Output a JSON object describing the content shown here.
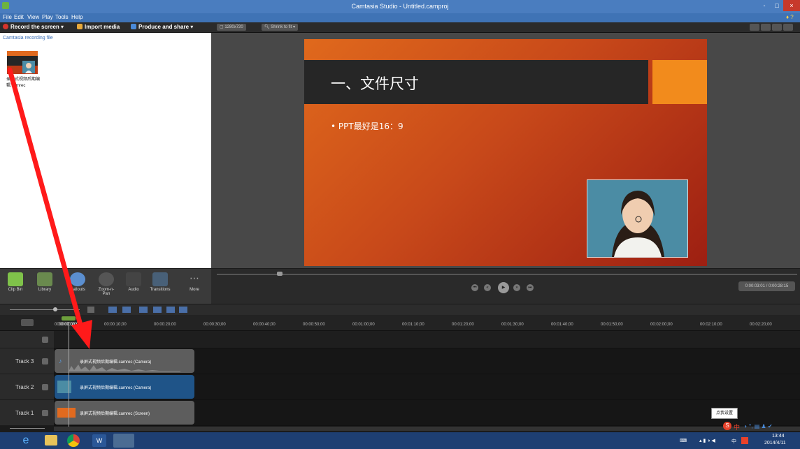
{
  "window": {
    "title": "Camtasia Studio - Untitled.camproj",
    "minimize": "-",
    "maximize": "□",
    "close": "×"
  },
  "menu": [
    "File",
    "Edit",
    "View",
    "Play",
    "Tools",
    "Help"
  ],
  "toolbar": {
    "record_label": "Record the screen ▾",
    "import_label": "Import media",
    "produce_label": "Produce and share ▾",
    "resolution": "1280x720",
    "zoom": "Shrink to fit"
  },
  "clip_bin": {
    "header": "Camtasia recording file",
    "items": [
      {
        "name_line1": "录屏式视频后期编",
        "name_line2": "辑.camrec"
      }
    ]
  },
  "slide": {
    "title": "一、文件尺寸",
    "bullet": "• PPT最好是16：9"
  },
  "tools": [
    "Clip Bin",
    "Library",
    "Callouts",
    "Zoom-n-Pan",
    "Audio",
    "Transitions",
    "More"
  ],
  "playback": {
    "time": "0:00:03:01 / 0:00:28:15"
  },
  "timeline": {
    "ruler_labels": [
      "00:00:00;00",
      "00:00:10;00",
      "00:00:20;00",
      "00:00:30;00",
      "00:00:40;00",
      "00:00:50;00",
      "00:01:00;00",
      "00:01:10;00",
      "00:01:20;00",
      "00:01:30;00",
      "00:01:40;00",
      "00:01:50;00",
      "00:02:00;00",
      "00:02:10;00",
      "00:02:20;00"
    ],
    "playhead_label": "00:00:03;01",
    "tracks": [
      {
        "label": "Track 3",
        "clip": "录屏式视频后期编辑.camrec (Camera)",
        "kind": "audio"
      },
      {
        "label": "Track 2",
        "clip": "录屏式视频后期编辑.camrec (Camera)",
        "kind": "video"
      },
      {
        "label": "Track 1",
        "clip": "录屏式视频后期编辑.camrec (Screen)",
        "kind": "screen"
      }
    ],
    "tooltip": "点我设置"
  },
  "taskbar": {
    "apps": [
      "internet-explorer",
      "file-explorer",
      "chrome",
      "word",
      "camtasia"
    ],
    "ime": "中",
    "time": "13:44",
    "date": "2014/4/11",
    "tray_lang": "中"
  }
}
